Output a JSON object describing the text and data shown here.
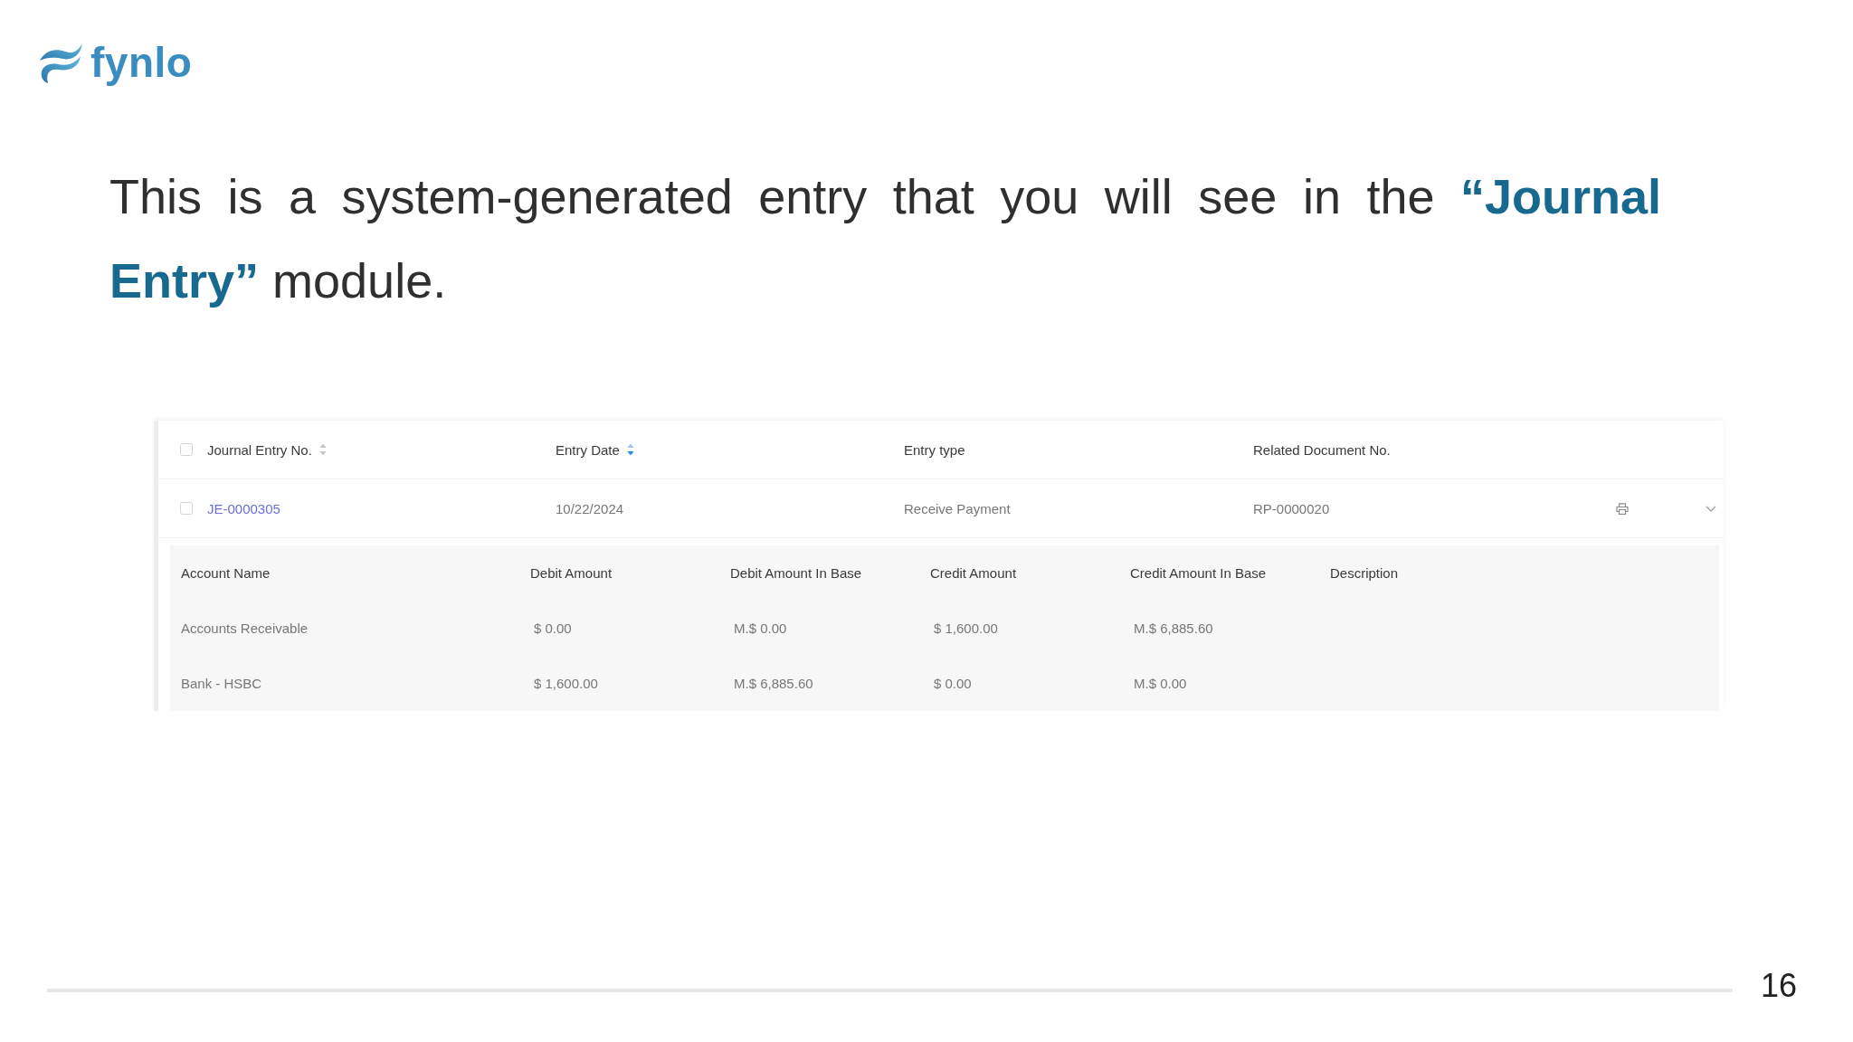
{
  "logo": {
    "text": "fynlo"
  },
  "intro": "This is a system-generated entry that you will see in the **“Journal Entry”** module.",
  "journal_table": {
    "select_all": {
      "checked": false
    },
    "columns": [
      {
        "label": "Journal Entry No.",
        "sortable": true,
        "sort_ascending": false,
        "sort_descending": false
      },
      {
        "label": "Entry Date",
        "sortable": true,
        "sort_ascending": false,
        "sort_descending": true
      },
      {
        "label": "Entry type",
        "sortable": false
      },
      {
        "label": "Related Document No.",
        "sortable": false
      }
    ],
    "rows": [
      {
        "checked": false,
        "entry_no": "JE-0000305",
        "entry_date": "10/22/2024",
        "entry_type": "Receive Payment",
        "related_document_no": "RP-0000020",
        "expanded": true,
        "detail": {
          "columns": [
            "Account Name",
            "Debit Amount",
            "Debit Amount In Base",
            "Credit Amount",
            "Credit Amount In Base",
            "Description"
          ],
          "rows": [
            [
              "Accounts Receivable",
              "$ 0.00",
              "M.$ 0.00",
              "$ 1,600.00",
              "M.$ 6,885.60"
            ],
            [
              "Bank - HSBC",
              "$ 1,600.00",
              "M.$ 6,885.60",
              "$ 0.00",
              "M.$ 0.00"
            ]
          ]
        }
      }
    ]
  },
  "page_number": "16"
}
